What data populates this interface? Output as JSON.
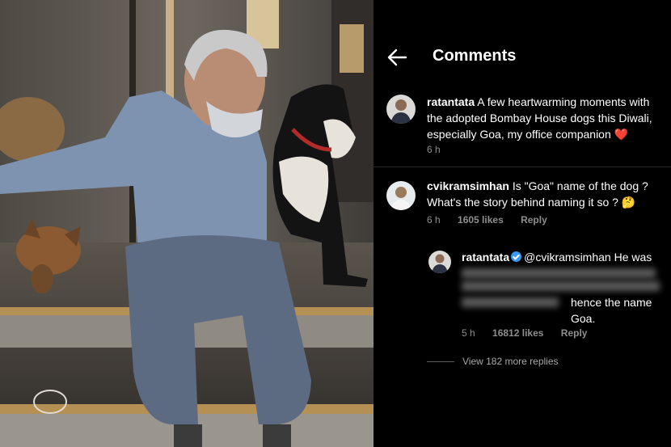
{
  "header": {
    "title": "Comments"
  },
  "post": {
    "username": "ratantata",
    "caption": " A few heartwarming moments with the  adopted Bombay House dogs this Diwali, especially Goa, my office companion",
    "emoji": "❤️",
    "time": "6 h"
  },
  "comment": {
    "username": "cvikramsimhan",
    "text": " Is \"Goa\" name of the dog ? What's the story behind naming it so ?",
    "emoji": "🤔",
    "time": "6 h",
    "likes": "1605 likes",
    "reply_label": "Reply"
  },
  "reply": {
    "username": "ratantata",
    "mention": "@cvikramsimhan",
    "text_start": " He was",
    "text_end": "hence the name Goa.",
    "time": "5 h",
    "likes": "16812 likes",
    "reply_label": "Reply"
  },
  "view_more": "View 182 more replies",
  "colors": {
    "heart": "#ed4956",
    "verified": "#3897f0",
    "meta": "#8e8e8e"
  },
  "icons": {
    "back": "arrow-left-icon",
    "verified": "verified-badge-icon"
  }
}
